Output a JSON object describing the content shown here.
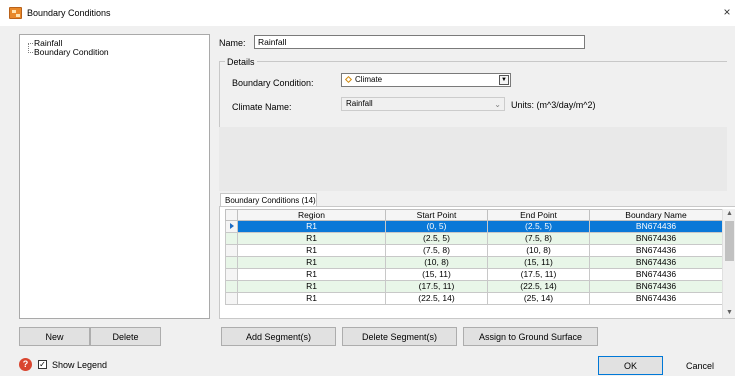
{
  "window": {
    "title": "Boundary Conditions",
    "close_glyph": "×"
  },
  "tree": {
    "items": [
      "Rainfall",
      "Boundary Condition"
    ]
  },
  "left_buttons": {
    "new_label": "New",
    "delete_label": "Delete"
  },
  "form": {
    "name_label": "Name:",
    "name_value": "Rainfall",
    "details_legend": "Details",
    "boundary_condition_label": "Boundary Condition:",
    "boundary_condition_value": "Climate",
    "boundary_condition_icon": "climate-diamond-icon",
    "climate_name_label": "Climate Name:",
    "climate_name_value": "Rainfall",
    "units_text": "Units: (m^3/day/m^2)"
  },
  "grid": {
    "tab_label": "Boundary Conditions (14)",
    "columns": [
      "Region",
      "Start Point",
      "End Point",
      "Boundary Name"
    ],
    "rows": [
      [
        "R1",
        "(0, 5)",
        "(2.5, 5)",
        "BN674436"
      ],
      [
        "R1",
        "(2.5, 5)",
        "(7.5, 8)",
        "BN674436"
      ],
      [
        "R1",
        "(7.5, 8)",
        "(10, 8)",
        "BN674436"
      ],
      [
        "R1",
        "(10, 8)",
        "(15, 11)",
        "BN674436"
      ],
      [
        "R1",
        "(15, 11)",
        "(17.5, 11)",
        "BN674436"
      ],
      [
        "R1",
        "(17.5, 11)",
        "(22.5, 14)",
        "BN674436"
      ],
      [
        "R1",
        "(22.5, 14)",
        "(25, 14)",
        "BN674436"
      ]
    ],
    "selected_row": 0
  },
  "segment_buttons": {
    "add_label": "Add Segment(s)",
    "delete_label": "Delete Segment(s)",
    "assign_label": "Assign to Ground Surface"
  },
  "footer": {
    "help_glyph": "?",
    "show_legend_label": "Show Legend",
    "show_legend_checked": true,
    "ok_label": "OK",
    "cancel_label": "Cancel"
  },
  "colors": {
    "selection": "#0a78d7",
    "alt_row": "#e8f6e8",
    "help_icon": "#d9452f",
    "app_icon": "#e8882a"
  }
}
